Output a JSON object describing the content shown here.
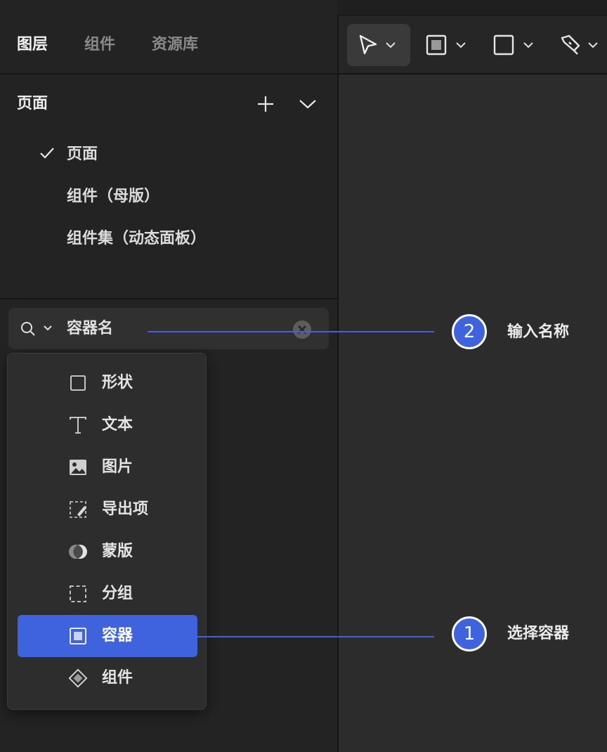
{
  "tabs": [
    {
      "label": "图层",
      "active": true
    },
    {
      "label": "组件",
      "active": false
    },
    {
      "label": "资源库",
      "active": false
    }
  ],
  "pages": {
    "title": "页面",
    "items": [
      {
        "label": "页面",
        "checked": true
      },
      {
        "label": "组件（母版）",
        "checked": false
      },
      {
        "label": "组件集（动态面板）",
        "checked": false
      }
    ]
  },
  "search": {
    "value": "容器名"
  },
  "type_menu": {
    "items": [
      {
        "label": "形状",
        "icon": "square-outline-icon",
        "selected": false
      },
      {
        "label": "文本",
        "icon": "text-icon",
        "selected": false
      },
      {
        "label": "图片",
        "icon": "image-icon",
        "selected": false
      },
      {
        "label": "导出项",
        "icon": "export-slice-icon",
        "selected": false
      },
      {
        "label": "蒙版",
        "icon": "mask-icon",
        "selected": false
      },
      {
        "label": "分组",
        "icon": "group-dashed-icon",
        "selected": false
      },
      {
        "label": "容器",
        "icon": "container-icon",
        "selected": true
      },
      {
        "label": "组件",
        "icon": "component-diamond-icon",
        "selected": false
      }
    ]
  },
  "toolbar": {
    "tools": [
      "pointer-tool-icon",
      "container-tool-icon",
      "rectangle-tool-icon",
      "pen-tool-icon"
    ]
  },
  "annotations": [
    {
      "number": "2",
      "text": "输入名称"
    },
    {
      "number": "1",
      "text": "选择容器"
    }
  ],
  "colors": {
    "accent": "#3e63dd",
    "panel_bg": "#232323",
    "canvas_bg": "#2c2c2c"
  }
}
